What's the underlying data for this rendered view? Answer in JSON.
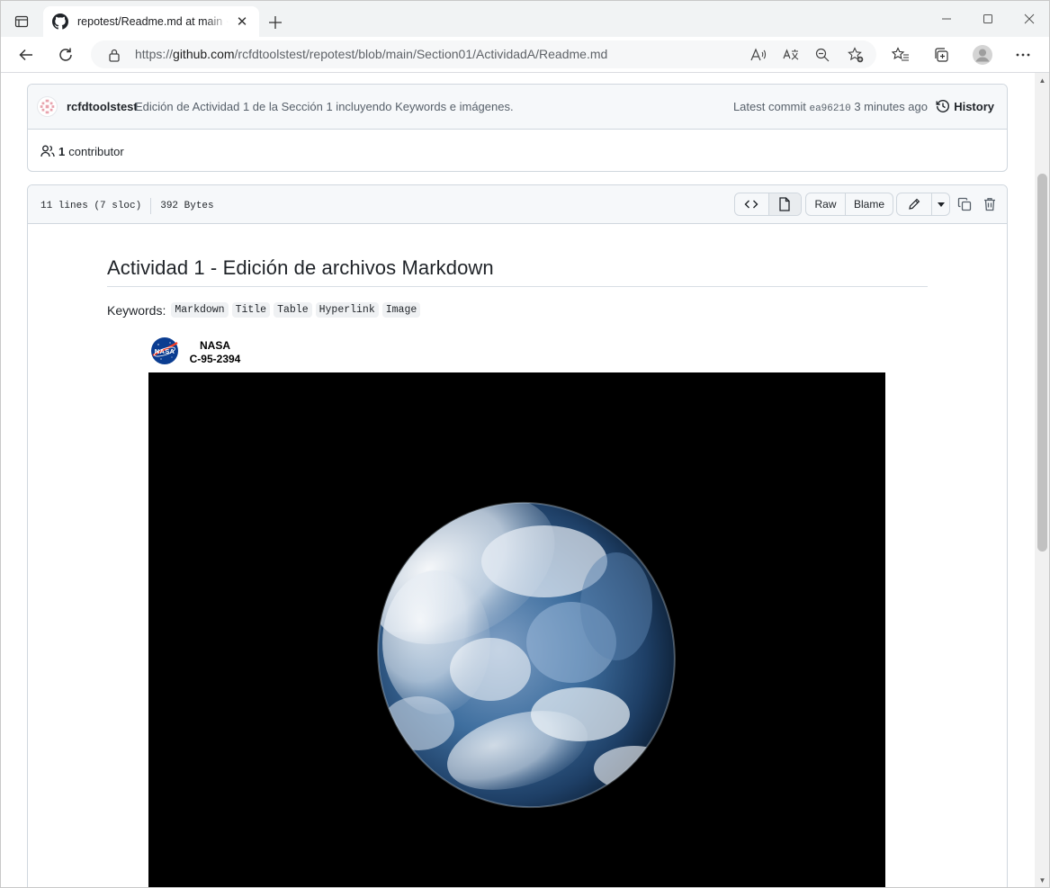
{
  "browser": {
    "tab_title": "repotest/Readme.md at main · rcfdtoolstest/repotest",
    "tab_close": "✕",
    "url_prefix": "https://",
    "url_host": "github.com",
    "url_path": "/rcfdtoolstest/repotest/blob/main/Section01/ActividadA/Readme.md"
  },
  "commit": {
    "author": "rcfdtoolstest",
    "message": "Edición de Actividad 1 de la Sección 1 incluyendo Keywords e imágenes.",
    "latest_label": "Latest commit",
    "sha": "ea96210",
    "time": "3 minutes ago",
    "history_label": "History",
    "contributors_count": "1",
    "contributors_label": "contributor"
  },
  "file": {
    "lines": "11 lines (7 sloc)",
    "size": "392 Bytes",
    "raw_label": "Raw",
    "blame_label": "Blame"
  },
  "readme": {
    "title": "Actividad 1 - Edición de archivos Markdown",
    "keywords_label": "Keywords:",
    "keywords": [
      "Markdown",
      "Title",
      "Table",
      "Hyperlink",
      "Image"
    ],
    "image_caption_line1": "NASA",
    "image_caption_line2": "C-95-2394"
  },
  "icons": {
    "tab_actions": "tab-actions-icon",
    "favicon": "github-icon",
    "back": "back-arrow-icon",
    "refresh": "refresh-icon",
    "lock": "lock-icon",
    "read_aloud": "read-aloud-icon",
    "translate": "translate-icon",
    "zoom": "zoom-out-icon",
    "favorite": "add-favorite-icon",
    "favorites": "favorites-icon",
    "collections": "collections-icon",
    "profile": "profile-icon",
    "menu": "more-icon",
    "history": "history-clock-icon",
    "people": "people-icon",
    "code": "code-icon",
    "preview": "file-icon",
    "edit": "pencil-icon",
    "dropdown": "triangle-down-icon",
    "copy": "copy-icon",
    "delete": "trash-icon"
  },
  "colors": {
    "link_text": "#1f2328",
    "muted_text": "#57606a",
    "border": "#d0d7de",
    "header_bg": "#f6f8fa"
  }
}
